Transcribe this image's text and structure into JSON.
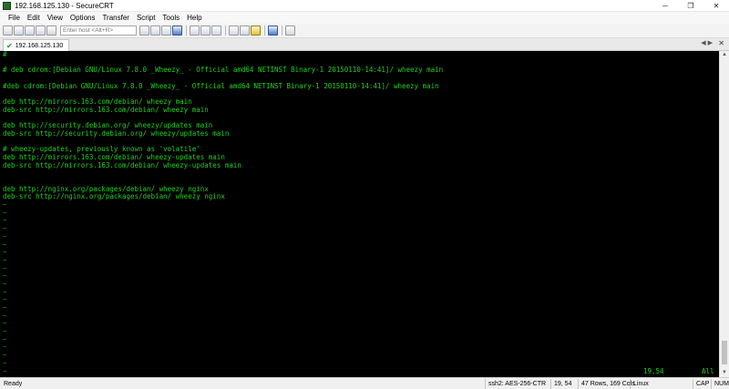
{
  "window": {
    "title": "192.168.125.130 - SecureCRT",
    "minimize_glyph": "─",
    "maximize_glyph": "❐",
    "close_glyph": "✕"
  },
  "menu": [
    "File",
    "Edit",
    "View",
    "Options",
    "Transfer",
    "Script",
    "Tools",
    "Help"
  ],
  "toolbar": {
    "host_placeholder": "Enter host <Alt+R>",
    "icons": [
      "connect-icon",
      "quick-connect-icon",
      "connect-tab-icon",
      "reconnect-icon",
      "disconnect-icon",
      "copy-icon",
      "paste-icon",
      "find-icon",
      "print-icon",
      "settings-icon",
      "key-icon",
      "help-icon"
    ]
  },
  "tab": {
    "label": "192.168.125.130",
    "nav_glyph": "◀ ▶",
    "close_glyph": "✕"
  },
  "terminal": {
    "lines": [
      "#",
      "",
      "# deb cdrom:[Debian GNU/Linux 7.8.0 _Wheezy_ - Official amd64 NETINST Binary-1 20150110-14:41]/ wheezy main",
      "",
      "#deb cdrom:[Debian GNU/Linux 7.8.0 _Wheezy_ - Official amd64 NETINST Binary-1 20150110-14:41]/ wheezy main",
      "",
      "deb http://mirrors.163.com/debian/ wheezy main",
      "deb-src http://mirrors.163.com/debian/ wheezy main",
      "",
      "deb http://security.debian.org/ wheezy/updates main",
      "deb-src http://security.debian.org/ wheezy/updates main",
      "",
      "# wheezy-updates, previously known as 'volatile'",
      "deb http://mirrors.163.com/debian/ wheezy-updates main",
      "deb-src http://mirrors.163.com/debian/ wheezy-updates main",
      "",
      "",
      "deb http://nginx.org/packages/debian/ wheezy nginx",
      "deb-src http://nginx.org/packages/debian/ wheezy nginx",
      "~",
      "~",
      "~",
      "~",
      "~",
      "~",
      "~",
      "~",
      "~",
      "~",
      "~",
      "~",
      "~",
      "~",
      "~",
      "~",
      "~",
      "~",
      "~",
      "~",
      "~",
      "~"
    ],
    "cursor_position": "19,54",
    "scroll_position": "All"
  },
  "status": {
    "ready": "Ready",
    "cipher": "ssh2: AES-256-CTR",
    "row_col": "19, 54",
    "size": "47 Rows, 169 Cols",
    "os": "Linux",
    "caps": "CAP",
    "num": "NUM"
  }
}
